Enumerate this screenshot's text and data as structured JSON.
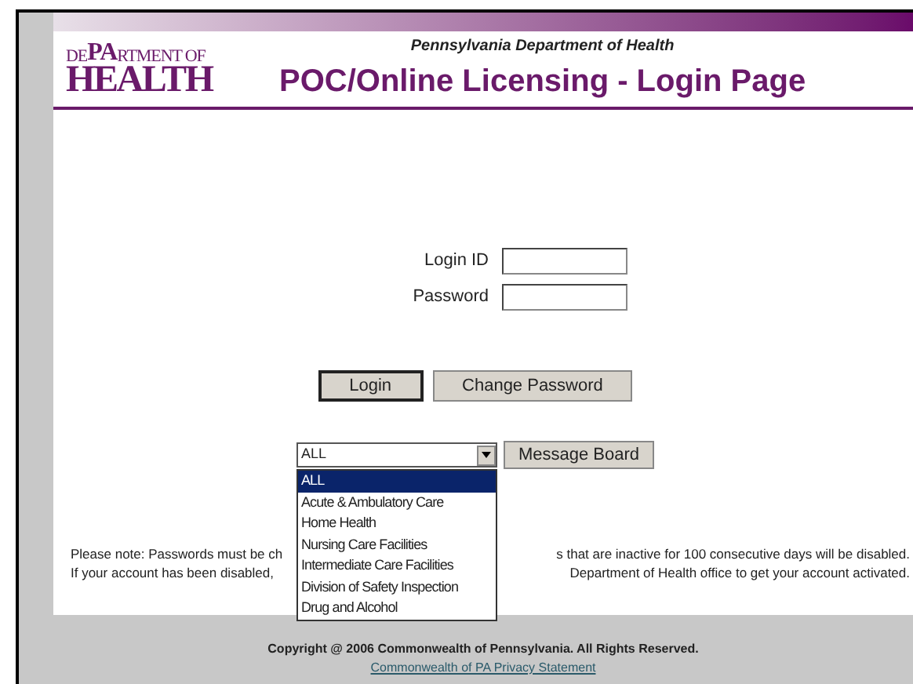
{
  "logo": {
    "top_left": "DE",
    "top_pa": "PA",
    "top_right": "RTMENT OF",
    "bottom": "HEALTH"
  },
  "header": {
    "subtitle": "Pennsylvania Department of Health",
    "title": "POC/Online Licensing - Login Page"
  },
  "login_form": {
    "fields": [
      {
        "label": "Login ID"
      },
      {
        "label": "Password"
      }
    ],
    "buttons": [
      {
        "label": "Login",
        "selected": true
      },
      {
        "label": "Change Password",
        "selected": false
      }
    ]
  },
  "board": {
    "select_value": "ALL",
    "options": [
      {
        "label": "ALL",
        "selected": true
      },
      {
        "label": "Acute & Ambulatory Care",
        "selected": false
      },
      {
        "label": "Home Health",
        "selected": false
      },
      {
        "label": "Nursing Care Facilities",
        "selected": false
      },
      {
        "label": "Intermediate Care Facilities",
        "selected": false
      },
      {
        "label": "Division of Safety Inspection",
        "selected": false
      },
      {
        "label": "Drug and Alcohol",
        "selected": false
      }
    ],
    "button": "Message Board"
  },
  "note": [
    {
      "left": "Please note: Passwords must be ch",
      "right": "s that are inactive for 100 consecutive days will be disabled."
    },
    {
      "left": "If your account has been disabled, ",
      "right": "Department of Health office to get your account activated."
    }
  ],
  "footer": {
    "copyright": "Copyright @ 2006 Commonwealth of Pennsylvania. All Rights Reserved.",
    "link": "Commonwealth of PA Privacy Statement"
  }
}
